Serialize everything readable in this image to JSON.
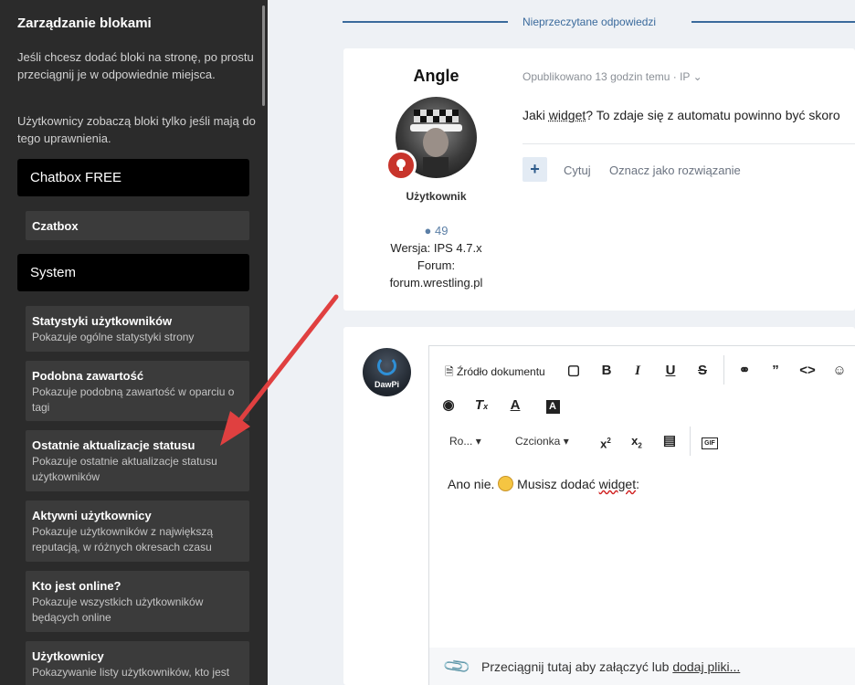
{
  "sidebar": {
    "title": "Zarządzanie blokami",
    "intro1": "Jeśli chcesz dodać bloki na stronę, po prostu przeciągnij je w odpowiednie miejsca.",
    "intro2": "Użytkownicy zobaczą bloki tylko jeśli mają do tego uprawnienia.",
    "category1": "Chatbox FREE",
    "block0": {
      "title": "Czatbox"
    },
    "category2": "System",
    "blocks": [
      {
        "title": "Statystyki użytkowników",
        "desc": "Pokazuje ogólne statystyki strony"
      },
      {
        "title": "Podobna zawartość",
        "desc": "Pokazuje podobną zawartość w oparciu o tagi"
      },
      {
        "title": "Ostatnie aktualizacje statusu",
        "desc": "Pokazuje ostatnie aktualizacje statusu użytkowników"
      },
      {
        "title": "Aktywni użytkownicy",
        "desc": "Pokazuje użytkowników z największą reputacją, w różnych okresach czasu"
      },
      {
        "title": "Kto jest online?",
        "desc": "Pokazuje wszystkich użytkowników będących online"
      },
      {
        "title": "Użytkownicy",
        "desc": "Pokazywanie listy użytkowników, kto jest"
      }
    ]
  },
  "header": {
    "tab_label": "Nieprzeczytane odpowiedzi"
  },
  "post": {
    "author": "Angle",
    "group": "Użytkownik",
    "post_count": "49",
    "version": "Wersja: IPS 4.7.x",
    "forum_label": "Forum:",
    "forum_value": "forum.wrestling.pl",
    "meta": "Opublikowano 13 godzin temu · IP",
    "content_pre": "Jaki ",
    "content_link": "widget",
    "content_post": "? To zdaje się z automatu powinno być skoro",
    "quote": "Cytuj",
    "solution": "Oznacz jako rozwiązanie"
  },
  "reply": {
    "avatar_label": "DawPi",
    "source_label": "Źródło dokumentu",
    "format_label": "Ro...",
    "font_label": "Czcionka",
    "gif_label": "GIF",
    "text_pre": "Ano nie. ",
    "text_mid": " Musisz dodać ",
    "text_word": "widget",
    "text_end": ":",
    "attach_pre": "Przeciągnij tutaj aby załączyć lub ",
    "attach_link": "dodaj pliki..."
  },
  "colors": {
    "sidebar_bg": "#2b2b2b",
    "accent": "#3a6a9c",
    "arrow": "#e04040"
  }
}
